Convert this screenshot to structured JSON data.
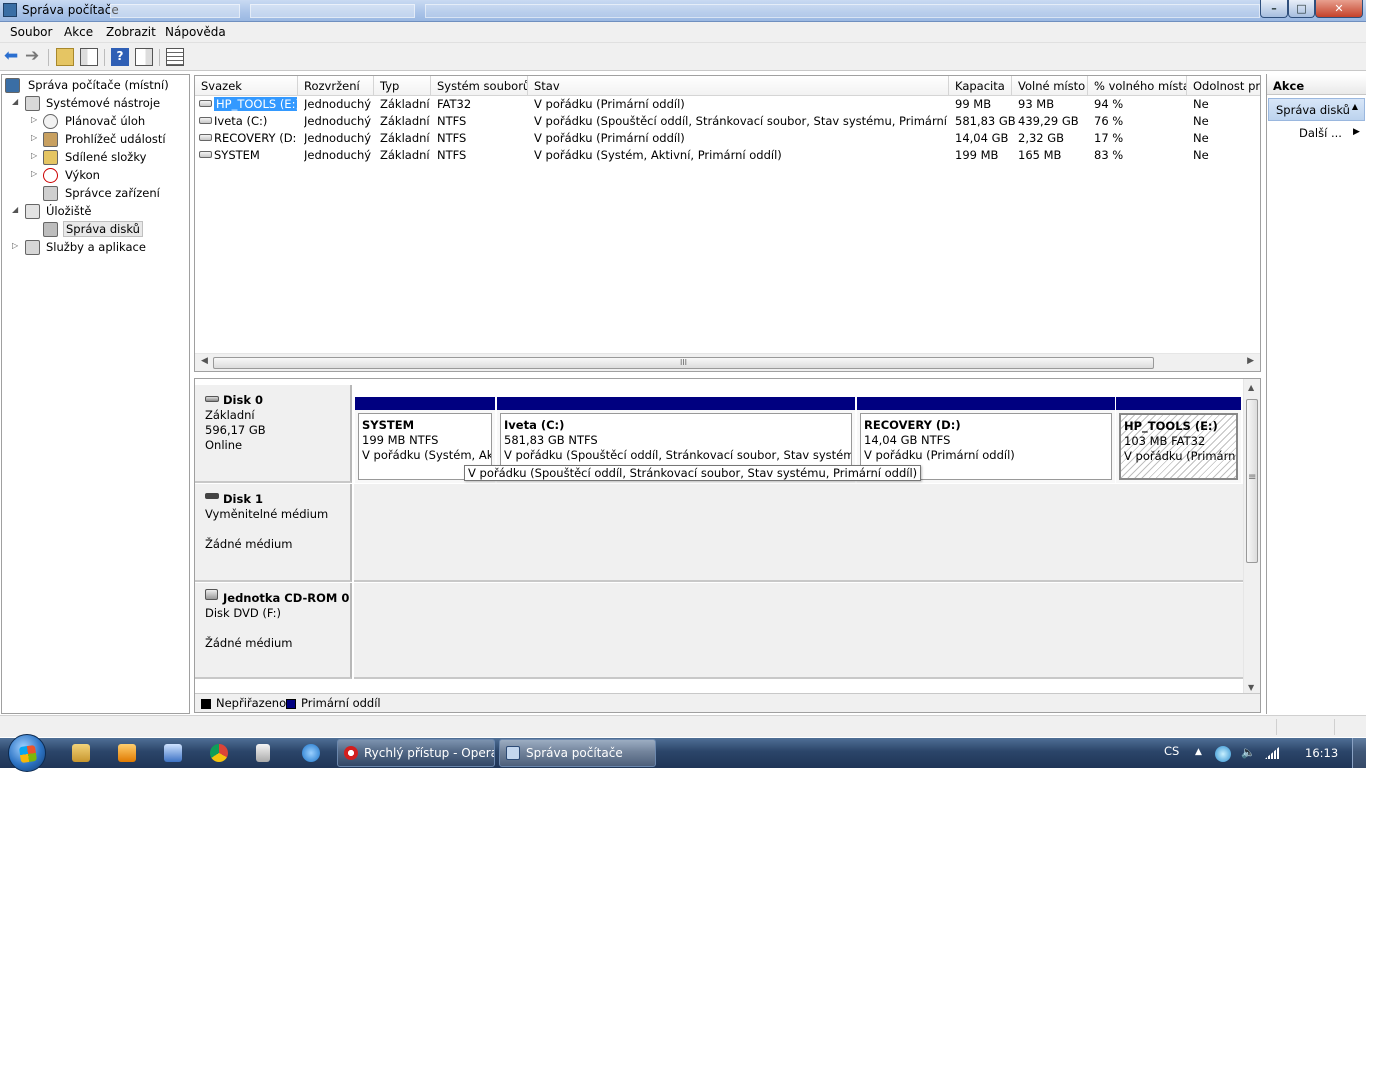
{
  "window": {
    "title": "Správa počítače",
    "controls": {
      "minimize": "–",
      "maximize": "□",
      "close": "✕"
    }
  },
  "menu": [
    "Soubor",
    "Akce",
    "Zobrazit",
    "Nápověda"
  ],
  "toolbar": {
    "back": "⬅",
    "forward": "➔",
    "help": "?"
  },
  "tree": {
    "root": "Správa počítače (místní)",
    "system_tools": "Systémové nástroje",
    "task_scheduler": "Plánovač úloh",
    "event_viewer": "Prohlížeč událostí",
    "shared_folders": "Sdílené složky",
    "performance": "Výkon",
    "device_manager": "Správce zařízení",
    "storage": "Úložiště",
    "disk_management": "Správa disků",
    "services": "Služby a aplikace",
    "expanded_glyph": "◢",
    "collapsed_glyph": "▷"
  },
  "volumes": {
    "columns": [
      "Svazek",
      "Rozvržení",
      "Typ",
      "Systém souborů",
      "Stav",
      "Kapacita",
      "Volné místo",
      "% volného místa",
      "Odolnost proti chybám"
    ],
    "rows": [
      {
        "name": "HP_TOOLS (E:)",
        "layout": "Jednoduchý",
        "type": "Základní",
        "fs": "FAT32",
        "status": "V pořádku (Primární oddíl)",
        "capacity": "99 MB",
        "free": "93 MB",
        "pct": "94 %",
        "fault": "Ne"
      },
      {
        "name": "Iveta (C:)",
        "layout": "Jednoduchý",
        "type": "Základní",
        "fs": "NTFS",
        "status": "V pořádku (Spouštěcí oddíl, Stránkovací soubor, Stav systému, Primární oddíl)",
        "capacity": "581,83 GB",
        "free": "439,29 GB",
        "pct": "76 %",
        "fault": "Ne"
      },
      {
        "name": "RECOVERY (D:)",
        "layout": "Jednoduchý",
        "type": "Základní",
        "fs": "NTFS",
        "status": "V pořádku (Primární oddíl)",
        "capacity": "14,04 GB",
        "free": "2,32 GB",
        "pct": "17 %",
        "fault": "Ne"
      },
      {
        "name": "SYSTEM",
        "layout": "Jednoduchý",
        "type": "Základní",
        "fs": "NTFS",
        "status": "V pořádku (Systém, Aktivní, Primární oddíl)",
        "capacity": "199 MB",
        "free": "165 MB",
        "pct": "83 %",
        "fault": "Ne"
      }
    ],
    "hscroll_grip": "III"
  },
  "disks": {
    "disk0": {
      "name": "Disk 0",
      "kind": "Základní",
      "size": "596,17 GB",
      "state": "Online",
      "partitions": [
        {
          "name": "SYSTEM",
          "size": "199 MB NTFS",
          "status": "V pořádku (Systém, Aktivní, Primární oddíl)"
        },
        {
          "name": "Iveta  (C:)",
          "size": "581,83 GB NTFS",
          "status": "V pořádku (Spouštěcí oddíl, Stránkovací soubor, Stav systému, Primární oddíl)"
        },
        {
          "name": "RECOVERY  (D:)",
          "size": "14,04 GB NTFS",
          "status": "V pořádku (Primární oddíl)"
        },
        {
          "name": "HP_TOOLS  (E:)",
          "size": "103 MB FAT32",
          "status": "V pořádku (Primární oddíl)"
        }
      ]
    },
    "disk1": {
      "name": "Disk 1",
      "kind": "Vyměnitelné médium",
      "state": "Žádné médium"
    },
    "cdrom0": {
      "name": "Jednotka CD-ROM 0",
      "kind": "Disk DVD (F:)",
      "state": "Žádné médium"
    },
    "tooltip": "V pořádku (Spouštěcí oddíl, Stránkovací soubor, Stav systému, Primární oddíl)",
    "vscroll_grip": "≡"
  },
  "legend": [
    {
      "label": "Nepřiřazeno",
      "color": "#000000"
    },
    {
      "label": "Primární oddíl",
      "color": "#000080"
    }
  ],
  "actions": {
    "header": "Akce",
    "section": "Správa disků",
    "more": "Další ..."
  },
  "taskbar": {
    "pinned": [
      "explorer-icon",
      "media-player-icon",
      "outlook-icon",
      "chrome-icon",
      "calculator-icon",
      "internet-explorer-icon"
    ],
    "tasks": [
      "Rychlý přístup - Opera",
      "Správa počítače"
    ],
    "language": "CS",
    "clock": "16:13"
  }
}
